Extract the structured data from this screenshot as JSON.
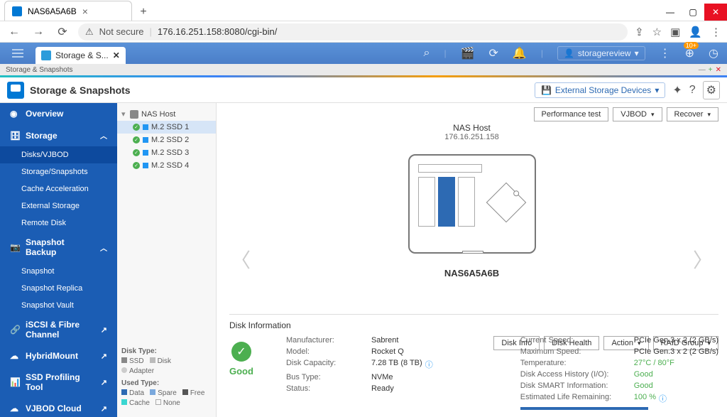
{
  "browser": {
    "tab_title": "NAS6A5A6B",
    "url": "176.16.251.158:8080/cgi-bin/",
    "not_secure": "Not secure"
  },
  "qnap": {
    "tab": "Storage & S...",
    "user": "storagereview",
    "badge": "10+"
  },
  "breadcrumb": "Storage & Snapshots",
  "app": {
    "title": "Storage & Snapshots",
    "ext_storage_btn": "External Storage Devices"
  },
  "sidebar": {
    "overview": "Overview",
    "storage": "Storage",
    "storage_items": [
      "Disks/VJBOD",
      "Storage/Snapshots",
      "Cache Acceleration",
      "External Storage",
      "Remote Disk"
    ],
    "snapshot": "Snapshot Backup",
    "snapshot_items": [
      "Snapshot",
      "Snapshot Replica",
      "Snapshot Vault"
    ],
    "iscsi": "iSCSI & Fibre Channel",
    "hybrid": "HybridMount",
    "ssd_profiling": "SSD Profiling Tool",
    "vjbod_cloud": "VJBOD Cloud"
  },
  "tree": {
    "host": "NAS Host",
    "disks": [
      "M.2 SSD 1",
      "M.2 SSD 2",
      "M.2 SSD 3",
      "M.2 SSD 4"
    ]
  },
  "legend": {
    "disk_type": "Disk Type:",
    "ssd": "SSD",
    "disk": "Disk",
    "adapter": "Adapter",
    "used_type": "Used Type:",
    "data": "Data",
    "spare": "Spare",
    "free": "Free",
    "cache": "Cache",
    "none": "None"
  },
  "top_buttons": {
    "perf": "Performance test",
    "vjbod": "VJBOD",
    "recover": "Recover"
  },
  "device": {
    "title": "NAS Host",
    "ip": "176.16.251.158",
    "name": "NAS6A5A6B"
  },
  "action_buttons": {
    "disk_info": "Disk Info",
    "disk_health": "Disk Health",
    "action": "Action",
    "raid_group": "RAID Group"
  },
  "disk_info": {
    "title": "Disk Information",
    "status": "Good",
    "left": {
      "manufacturer": {
        "label": "Manufacturer:",
        "value": "Sabrent"
      },
      "model": {
        "label": "Model:",
        "value": "Rocket Q"
      },
      "capacity": {
        "label": "Disk Capacity:",
        "value": "7.28 TB (8 TB)"
      },
      "bus": {
        "label": "Bus Type:",
        "value": "NVMe"
      },
      "status_row": {
        "label": "Status:",
        "value": "Ready"
      }
    },
    "right": {
      "cur_speed": {
        "label": "Current Speed:",
        "value": "PCIe Gen.3 x 2 (2 GB/s)"
      },
      "max_speed": {
        "label": "Maximum Speed:",
        "value": "PCIe Gen.3 x 2 (2 GB/s)"
      },
      "temp": {
        "label": "Temperature:",
        "value": "27°C / 80°F"
      },
      "access": {
        "label": "Disk Access History (I/O):",
        "value": "Good"
      },
      "smart": {
        "label": "Disk SMART Information:",
        "value": "Good"
      },
      "life": {
        "label": "Estimated Life Remaining:",
        "value": "100 %"
      }
    }
  }
}
